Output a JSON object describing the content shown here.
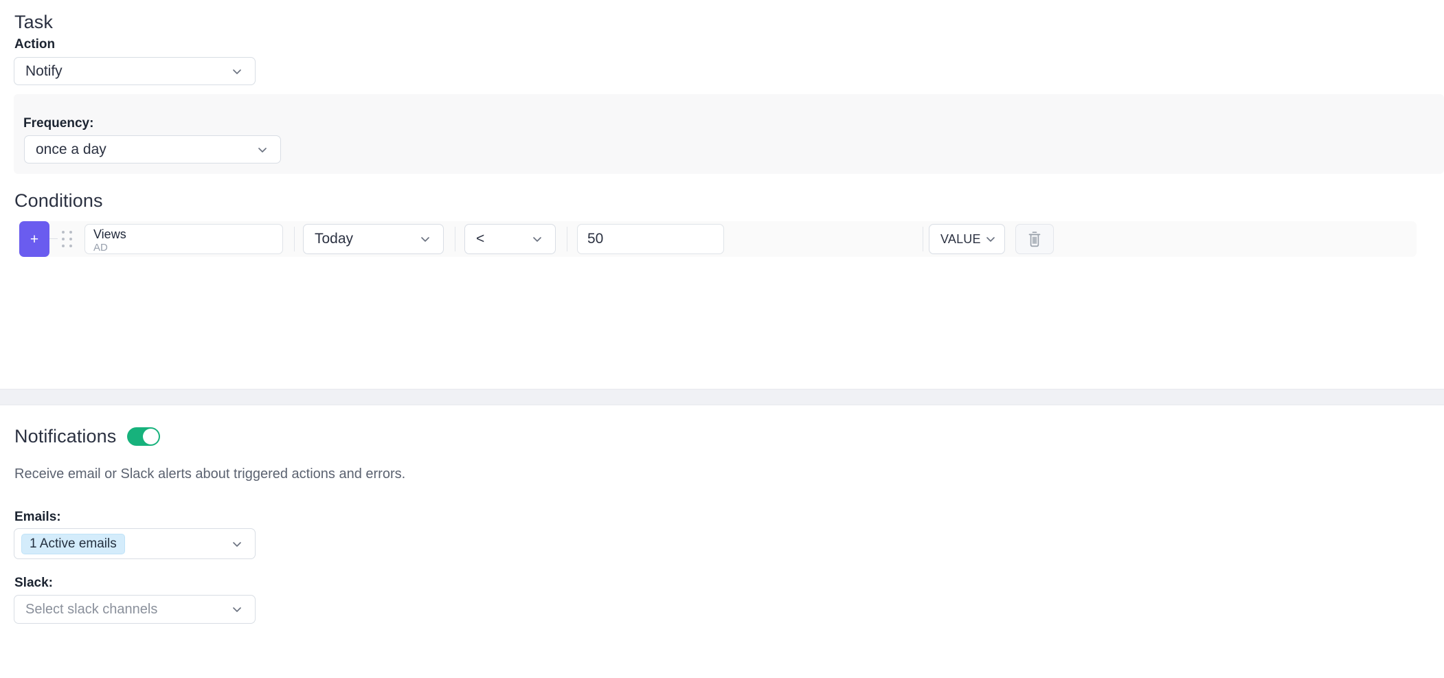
{
  "task": {
    "title": "Task",
    "action_label": "Action",
    "action_value": "Notify",
    "frequency_label": "Frequency:",
    "frequency_value": "once a day"
  },
  "conditions": {
    "title": "Conditions",
    "add_button_label": "+",
    "drag_handle_icon": "drag-handle-icon",
    "delete_icon": "trash-icon",
    "row": {
      "metric_name": "Views",
      "metric_sub": "AD",
      "range_value": "Today",
      "operator_value": "<",
      "threshold_value": "50",
      "value_type": "VALUE"
    }
  },
  "notifications": {
    "title": "Notifications",
    "toggle_state": "on",
    "description": "Receive email or Slack alerts about triggered actions and errors.",
    "emails_label": "Emails:",
    "emails_chip": "1 Active emails",
    "slack_label": "Slack:",
    "slack_placeholder": "Select slack channels"
  },
  "colors": {
    "accent_purple": "#6a5cef",
    "toggle_green": "#17b27c",
    "chip_blue": "#d4ecfb",
    "panel_gray": "#f8f8f9",
    "separator_gray": "#f0f1f5"
  }
}
